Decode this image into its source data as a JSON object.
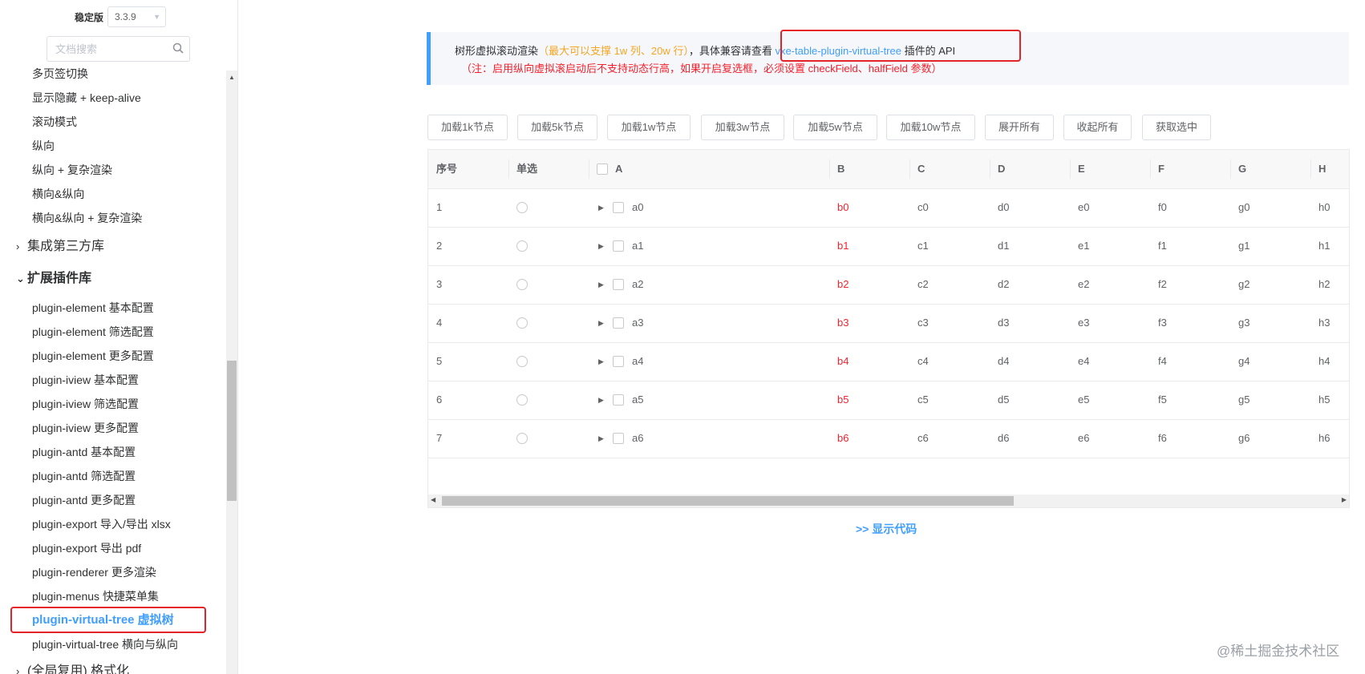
{
  "sidebar": {
    "version_label": "稳定版",
    "version_value": "3.3.9",
    "search_placeholder": "文档搜索",
    "items": [
      {
        "label": "多页签切换"
      },
      {
        "label": "显示隐藏 + keep-alive"
      },
      {
        "label": "滚动模式"
      },
      {
        "label": "纵向"
      },
      {
        "label": "纵向 + 复杂渲染"
      },
      {
        "label": "横向&纵向"
      },
      {
        "label": "横向&纵向 + 复杂渲染"
      }
    ],
    "group_third_party": "集成第三方库",
    "group_plugins": "扩展插件库",
    "plugin_items": [
      {
        "label": "plugin-element 基本配置"
      },
      {
        "label": "plugin-element 筛选配置"
      },
      {
        "label": "plugin-element 更多配置"
      },
      {
        "label": "plugin-iview 基本配置"
      },
      {
        "label": "plugin-iview 筛选配置"
      },
      {
        "label": "plugin-iview 更多配置"
      },
      {
        "label": "plugin-antd 基本配置"
      },
      {
        "label": "plugin-antd 筛选配置"
      },
      {
        "label": "plugin-antd 更多配置"
      },
      {
        "label": "plugin-export 导入/导出 xlsx"
      },
      {
        "label": "plugin-export 导出 pdf"
      },
      {
        "label": "plugin-renderer 更多渲染"
      },
      {
        "label": "plugin-menus 快捷菜单集"
      },
      {
        "label": "plugin-virtual-tree 虚拟树",
        "active": true
      },
      {
        "label": "plugin-virtual-tree 横向与纵向"
      }
    ],
    "group_global": "(全局复用) 格式化"
  },
  "tip": {
    "line1_a": "树形虚拟滚动渲染",
    "line1_b": "（最大可以支撑 1w 列、20w 行）",
    "line1_c": "，具体兼容请查看 ",
    "line1_link": "vxe-table-plugin-virtual-tree",
    "line1_d": " 插件的 API",
    "line2": "（注：启用纵向虚拟滚启动后不支持动态行高，如果开启复选框，必须设置 checkField、halfField 参数）"
  },
  "toolbar": {
    "buttons": [
      "加载1k节点",
      "加载5k节点",
      "加载1w节点",
      "加载3w节点",
      "加载5w节点",
      "加载10w节点",
      "展开所有",
      "收起所有",
      "获取选中"
    ]
  },
  "grid": {
    "headers": [
      "序号",
      "单选",
      "A",
      "B",
      "C",
      "D",
      "E",
      "F",
      "G",
      "H"
    ],
    "rows": [
      {
        "seq": "1",
        "a": "a0",
        "b": "b0",
        "c": "c0",
        "d": "d0",
        "e": "e0",
        "f": "f0",
        "g": "g0",
        "h": "h0"
      },
      {
        "seq": "2",
        "a": "a1",
        "b": "b1",
        "c": "c1",
        "d": "d1",
        "e": "e1",
        "f": "f1",
        "g": "g1",
        "h": "h1"
      },
      {
        "seq": "3",
        "a": "a2",
        "b": "b2",
        "c": "c2",
        "d": "d2",
        "e": "e2",
        "f": "f2",
        "g": "g2",
        "h": "h2"
      },
      {
        "seq": "4",
        "a": "a3",
        "b": "b3",
        "c": "c3",
        "d": "d3",
        "e": "e3",
        "f": "f3",
        "g": "g3",
        "h": "h3"
      },
      {
        "seq": "5",
        "a": "a4",
        "b": "b4",
        "c": "c4",
        "d": "d4",
        "e": "e4",
        "f": "f4",
        "g": "g4",
        "h": "h4"
      },
      {
        "seq": "6",
        "a": "a5",
        "b": "b5",
        "c": "c5",
        "d": "d5",
        "e": "e5",
        "f": "f5",
        "g": "g5",
        "h": "h5"
      },
      {
        "seq": "7",
        "a": "a6",
        "b": "b6",
        "c": "c6",
        "d": "d6",
        "e": "e6",
        "f": "f6",
        "g": "g6",
        "h": "h6"
      }
    ]
  },
  "show_code": ">> 显示代码",
  "watermark": "@稀土掘金技术社区",
  "colors": {
    "accent": "#409eff",
    "highlight": "#e5212a",
    "red_text": "#f5222d",
    "orange_text": "#f5a623"
  }
}
